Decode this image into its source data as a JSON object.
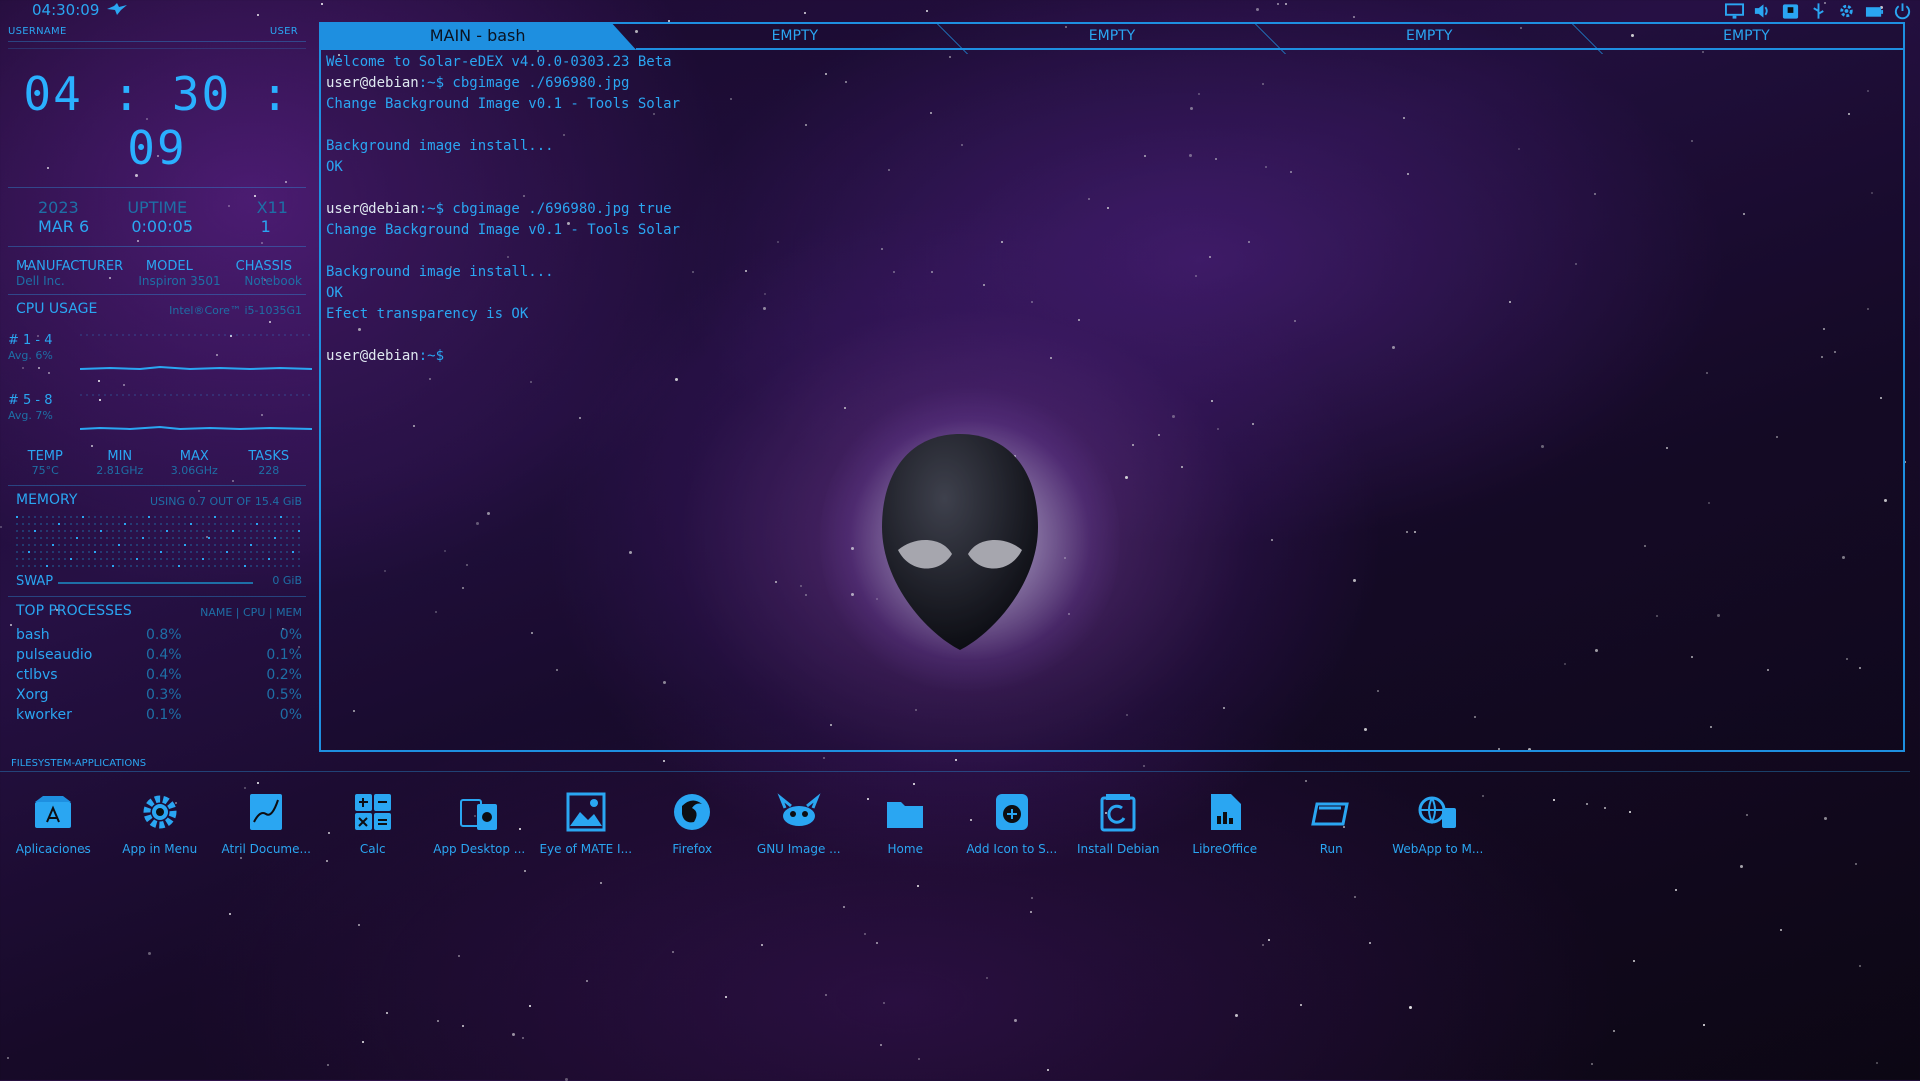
{
  "topbar": {
    "time": "04:30:09"
  },
  "left": {
    "username_label": "USERNAME",
    "user_value": "USER",
    "clock": "04 : 30 : 09",
    "date": {
      "year": "2023",
      "day": "MAR 6",
      "uptime_label": "UPTIME",
      "uptime": "0:00:05",
      "x11_label": "X11",
      "x11": "1"
    },
    "hardware": {
      "manufacturer_label": "MANUFACTURER",
      "manufacturer": "Dell Inc.",
      "model_label": "MODEL",
      "model": "Inspiron 3501",
      "chassis_label": "CHASSIS",
      "chassis": "Notebook"
    },
    "cpu": {
      "title": "CPU USAGE",
      "name": "Intel®Core™ i5-1035G1",
      "group1": {
        "label": "# 1 - 4",
        "avg": "Avg. 6%"
      },
      "group2": {
        "label": "# 5 - 8",
        "avg": "Avg. 7%"
      },
      "temp_label": "TEMP",
      "temp": "75°C",
      "min_label": "MIN",
      "min": "2.81GHz",
      "max_label": "MAX",
      "max": "3.06GHz",
      "tasks_label": "TASKS",
      "tasks": "228"
    },
    "memory": {
      "title": "MEMORY",
      "usage": "USING 0.7 OUT OF 15.4 GiB"
    },
    "swap": {
      "label": "SWAP",
      "value": "0 GiB"
    },
    "processes": {
      "title": "TOP PROCESSES",
      "columns": "NAME | CPU | MEM",
      "rows": [
        {
          "name": "bash",
          "cpu": "0.8%",
          "mem": "0%"
        },
        {
          "name": "pulseaudio",
          "cpu": "0.4%",
          "mem": "0.1%"
        },
        {
          "name": "ctlbvs",
          "cpu": "0.4%",
          "mem": "0.2%"
        },
        {
          "name": "Xorg",
          "cpu": "0.3%",
          "mem": "0.5%"
        },
        {
          "name": "kworker",
          "cpu": "0.1%",
          "mem": "0%"
        }
      ]
    }
  },
  "terminal": {
    "tabs": [
      "MAIN - bash",
      "EMPTY",
      "EMPTY",
      "EMPTY",
      "EMPTY"
    ],
    "lines": [
      {
        "prompt": "",
        "text": "Welcome to Solar-eDEX v4.0.0-0303.23 Beta"
      },
      {
        "prompt": "user@debian",
        "text": ":~$ cbgimage ./696980.jpg"
      },
      {
        "prompt": "",
        "text": "Change Background Image v0.1 - Tools Solar"
      },
      {
        "prompt": "",
        "text": ""
      },
      {
        "prompt": "",
        "text": "Background image install..."
      },
      {
        "prompt": "",
        "text": "OK"
      },
      {
        "prompt": "",
        "text": ""
      },
      {
        "prompt": "user@debian",
        "text": ":~$ cbgimage ./696980.jpg true"
      },
      {
        "prompt": "",
        "text": "Change Background Image v0.1 - Tools Solar"
      },
      {
        "prompt": "",
        "text": ""
      },
      {
        "prompt": "",
        "text": "Background image install..."
      },
      {
        "prompt": "",
        "text": "OK"
      },
      {
        "prompt": "",
        "text": "Efect transparency is OK"
      },
      {
        "prompt": "",
        "text": ""
      },
      {
        "prompt": "user@debian",
        "text": ":~$"
      }
    ]
  },
  "filesystem": {
    "label": "FILESYSTEM-APPLICATIONS",
    "apps": [
      {
        "label": "Aplicaciones",
        "icon": "app-store-icon"
      },
      {
        "label": "App in Menu",
        "icon": "gear-icon"
      },
      {
        "label": "Atril Docume...",
        "icon": "document-viewer-icon"
      },
      {
        "label": "Calc",
        "icon": "calculator-icon"
      },
      {
        "label": "App Desktop ...",
        "icon": "app-desktop-icon"
      },
      {
        "label": "Eye of MATE I...",
        "icon": "image-viewer-icon"
      },
      {
        "label": "Firefox",
        "icon": "firefox-icon"
      },
      {
        "label": "GNU Image ...",
        "icon": "gimp-icon"
      },
      {
        "label": "Home",
        "icon": "folder-icon"
      },
      {
        "label": "Add Icon to S...",
        "icon": "add-icon-icon"
      },
      {
        "label": "Install Debian",
        "icon": "debian-installer-icon"
      },
      {
        "label": "LibreOffice",
        "icon": "libreoffice-icon"
      },
      {
        "label": "Run",
        "icon": "run-icon"
      },
      {
        "label": "WebApp to M...",
        "icon": "webapp-icon"
      }
    ]
  },
  "colors": {
    "accent": "#2aa6f2",
    "accent_dark": "#1e8fe0",
    "dim": "#1e6fa6"
  }
}
